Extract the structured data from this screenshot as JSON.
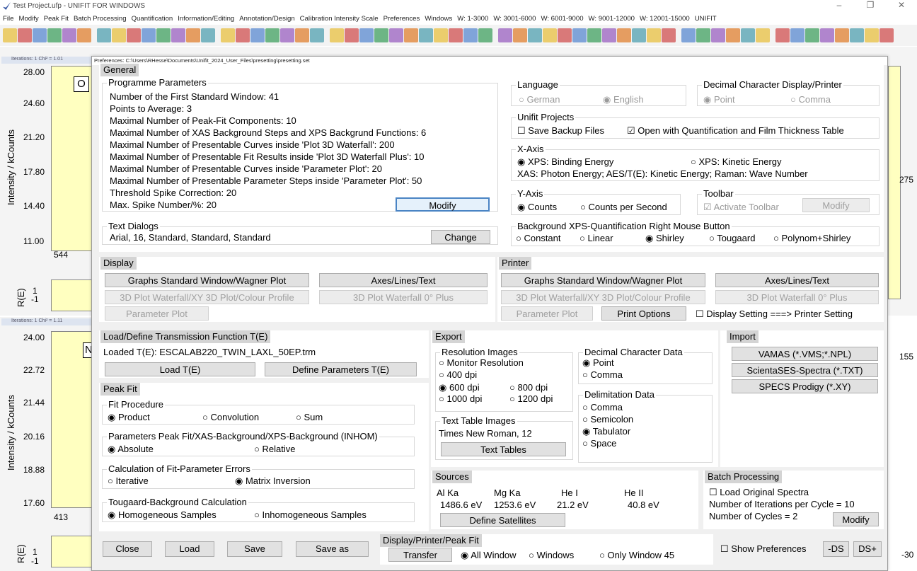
{
  "window": {
    "title": "Test Project.ufp - UNIFIT FOR WINDOWS",
    "controls": [
      "–",
      "❐",
      "✕"
    ]
  },
  "menu": [
    "File",
    "Modify",
    "Peak Fit",
    "Batch Processing",
    "Quantification",
    "Information/Editing",
    "Annotation/Design",
    "Calibration Intensity Scale",
    "Preferences",
    "Windows",
    "W: 1-3000",
    "W: 3001-6000",
    "W: 6001-9000",
    "W: 9001-12000",
    "W: 12001-15000",
    "UNIFIT"
  ],
  "background": {
    "top_plot": {
      "header": "Iterations: 1 Chi² = 1.01",
      "yticks": [
        "28.00",
        "24.60",
        "21.20",
        "17.80",
        "14.40",
        "11.00"
      ],
      "ylabel": "Intensity / kCounts",
      "box_letter": "O",
      "bottom_num": "544",
      "right_num": "275",
      "resid_label": "R(E)",
      "resid_ticks": [
        "1",
        "-1"
      ]
    },
    "bottom_plot": {
      "header": "Iterations: 1 Chi² = 1.11",
      "yticks": [
        "24.00",
        "22.72",
        "21.44",
        "20.16",
        "18.88",
        "17.60"
      ],
      "ylabel": "Intensity / kCounts",
      "box_letter": "N",
      "bottom_num": "413",
      "right_num": "155",
      "resid_label": "R(E)",
      "resid_ticks": [
        "1",
        "-1"
      ],
      "right_num2": "-30"
    }
  },
  "dialog": {
    "title": "Preferences: C:\\Users\\RHesse\\Documents\\Unifit_2024_User_Files\\presetting\\presetting.set",
    "general": {
      "header": "General",
      "programme": {
        "title": "Programme Parameters",
        "lines": [
          "Number of the First Standard Window: 41",
          "Points to Average: 3",
          "Maximal Number of Peak-Fit Components: 10",
          "Maximal Number of XAS Background Steps and XPS Backgrund Functions: 6",
          "Maximal Number of Presentable Curves inside 'Plot 3D Waterfall':  200",
          "Maximal Number of Presentable Fit Results inside 'Plot 3D Waterfall Plus': 10",
          "Maximal Number of Presentable Curves inside 'Parameter Plot': 20",
          "Maximal Number of Presentable Parameter Steps inside 'Parameter Plot': 50",
          "Threshold Spike Correction: 20",
          "Max. Spike Number/%: 20"
        ],
        "modify": "Modify"
      },
      "text_dialogs": {
        "title": "Text Dialogs",
        "value": "Arial, 16, Standard, Standard, Standard",
        "change": "Change"
      },
      "language": {
        "title": "Language",
        "german": "German",
        "english": "English"
      },
      "decimal": {
        "title": "Decimal Character Display/Printer",
        "point": "Point",
        "comma": "Comma"
      },
      "projects": {
        "title": "Unifit Projects",
        "backup": "Save Backup Files",
        "open": "Open with Quantification and Film Thickness Table"
      },
      "xaxis": {
        "title": "X-Axis",
        "binding": "XPS: Binding Energy",
        "kinetic": "XPS: Kinetic Energy",
        "note": "XAS: Photon Energy; AES/T(E): Kinetic Energy; Raman: Wave Number"
      },
      "yaxis": {
        "title": "Y-Axis",
        "counts": "Counts",
        "cps": "Counts per Second"
      },
      "toolbar": {
        "title": "Toolbar",
        "activate": "Activate Toolbar",
        "modify": "Modify"
      },
      "bg": {
        "title": "Background XPS-Quantification Right Mouse Button",
        "opts": [
          "Constant",
          "Linear",
          "Shirley",
          "Tougaard",
          "Polynom+Shirley"
        ]
      }
    },
    "display": {
      "header": "Display",
      "b1": "Graphs Standard Window/Wagner Plot",
      "b2": "Axes/Lines/Text",
      "b3": "3D Plot Waterfall/XY 3D Plot/Colour Profile",
      "b4": "3D Plot Waterfall 0° Plus",
      "b5": "Parameter Plot"
    },
    "printer": {
      "header": "Printer",
      "b1": "Graphs Standard Window/Wagner Plot",
      "b2": "Axes/Lines/Text",
      "b3": "3D Plot Waterfall/XY 3D Plot/Colour Profile",
      "b4": "3D Plot Waterfall 0° Plus",
      "b5": "Parameter Plot",
      "b6": "Print Options",
      "chk": "Display Setting ===> Printer Setting"
    },
    "transmission": {
      "header": "Load/Define Transmission Function T(E)",
      "loaded": "Loaded T(E): ESCALAB220_TWIN_LAXL_50EP.trm",
      "load": "Load T(E)",
      "define": "Define Parameters T(E)"
    },
    "peakfit": {
      "header": "Peak Fit",
      "proc": {
        "title": "Fit Procedure",
        "o1": "Product",
        "o2": "Convolution",
        "o3": "Sum"
      },
      "params": {
        "title": "Parameters Peak Fit/XAS-Background/XPS-Background (INHOM)",
        "o1": "Absolute",
        "o2": "Relative"
      },
      "errors": {
        "title": "Calculation of Fit-Parameter Errors",
        "o1": "Iterative",
        "o2": "Matrix Inversion"
      },
      "tougaard": {
        "title": "Tougaard-Background Calculation",
        "o1": "Homogeneous Samples",
        "o2": "Inhomogeneous Samples"
      }
    },
    "export": {
      "header": "Export",
      "res": {
        "title": "Resolution Images",
        "o1": "Monitor Resolution",
        "o2": "400 dpi",
        "o3": "600 dpi",
        "o4": "800 dpi",
        "o5": "1000 dpi",
        "o6": "1200 dpi"
      },
      "dec": {
        "title": "Decimal Character Data",
        "o1": "Point",
        "o2": "Comma"
      },
      "delim": {
        "title": "Delimitation Data",
        "o1": "Comma",
        "o2": "Semicolon",
        "o3": "Tabulator",
        "o4": "Space"
      },
      "tt": {
        "title": "Text Table Images",
        "value": "Times New Roman, 12",
        "btn": "Text Tables"
      }
    },
    "import": {
      "header": "Import",
      "b1": "VAMAS (*.VMS;*.NPL)",
      "b2": "ScientaSES-Spectra (*.TXT)",
      "b3": "SPECS Prodigy (*.XY)"
    },
    "sources": {
      "header": "Sources",
      "names": [
        "Al Ka",
        "Mg Ka",
        "He I",
        "He II"
      ],
      "values": [
        "1486.6 eV",
        "1253.6 eV",
        "21.2 eV",
        "40.8 eV"
      ],
      "btn": "Define Satellites"
    },
    "batch": {
      "header": "Batch Processing",
      "chk": "Load Original Spectra",
      "iter": "Number of Iterations per Cycle = 10",
      "cycles": "Number of Cycles = 2",
      "modify": "Modify"
    },
    "footer": {
      "close": "Close",
      "load": "Load",
      "save": "Save",
      "saveas": "Save as",
      "dpp": "Display/Printer/Peak Fit",
      "transfer": "Transfer",
      "all": "All Window",
      "windows": "Windows",
      "only": "Only Window  45",
      "show": "Show Preferences",
      "ds_minus": "-DS",
      "ds_plus": "DS+"
    }
  },
  "colors": {
    "accent": "#4a84c4",
    "section_header": "#d4d4d4",
    "plot_bg": "#ffffc0"
  }
}
